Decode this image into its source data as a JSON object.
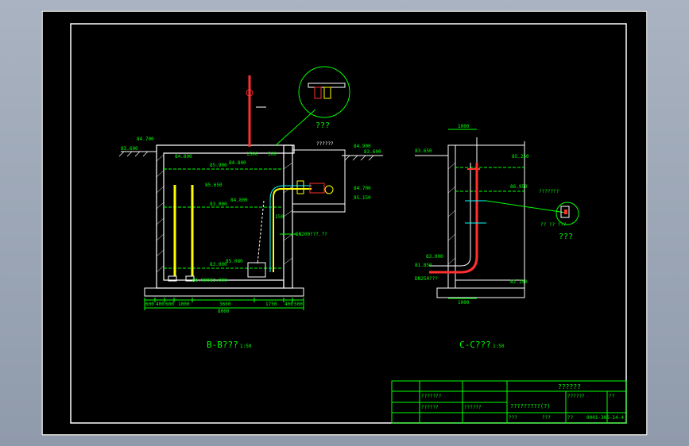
{
  "sheet": {
    "section_b_title": "B-B???",
    "section_b_scale": "1:50",
    "section_c_title": "C-C???",
    "section_c_scale": "1:50"
  },
  "detail_labels": [
    "???",
    "???"
  ],
  "section_b": {
    "elevations": [
      "84.700",
      "83.600",
      "84.800",
      "85.900",
      "84.800",
      "85.650",
      "83.000",
      "84.800",
      "83.000",
      "85.080",
      "83.000",
      "81.800",
      "84.900",
      "83.600",
      "84.700",
      "85.150"
    ],
    "small_labels": [
      "1500",
      "500",
      "150",
      "??????",
      "DN200???.??"
    ],
    "dims_bottom": [
      "600",
      "400",
      "600",
      "1000",
      "3650",
      "1750",
      "400",
      "500"
    ],
    "dim_total": "8000"
  },
  "section_c": {
    "dims_top": [
      "1000"
    ],
    "dims_bottom": [
      "1000"
    ],
    "elevations": [
      "83.650",
      "85.250",
      "86.950",
      "83.000",
      "81.850",
      "82.150",
      "DN250???"
    ],
    "labels": [
      "???????",
      "?? ?? ???"
    ]
  },
  "title_block": {
    "company": "??????",
    "drawing_name": "?????????(?)",
    "drawing_no": "0001-306-14-4",
    "cells": [
      "???????",
      "??????",
      "??????",
      "??????",
      "??",
      "???",
      "???",
      "??"
    ]
  },
  "colors": {
    "background": "#000000",
    "frame": "#ffffff",
    "annotation": "#00ff00",
    "structure": "#ffffff",
    "pipe_red": "#ff3030",
    "pipe_yellow": "#ffff00",
    "pipe_cyan": "#00ffff"
  }
}
